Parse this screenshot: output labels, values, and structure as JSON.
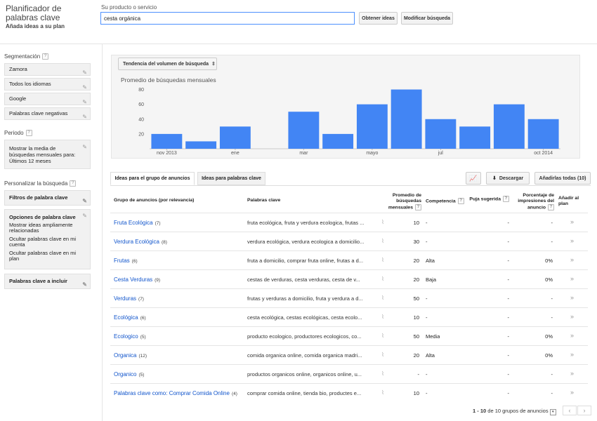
{
  "header": {
    "title": "Planificador de palabras clave",
    "subtitle": "Añada ideas a su plan",
    "product_label": "Su producto o servicio",
    "search_value": "cesta orgánica",
    "get_ideas_label": "Obtener ideas",
    "modify_label": "Modificar búsqueda"
  },
  "sidebar": {
    "segmentation_title": "Segmentación",
    "segmentation_items": [
      "Zamora",
      "Todos los idiomas",
      "Google",
      "Palabras clave negativas"
    ],
    "period_title": "Periodo",
    "period_text": "Mostrar la media de búsquedas mensuales para: Últimos 12 meses",
    "customize_title": "Personalizar la búsqueda",
    "filter_title": "Filtros de palabra clave",
    "options_title": "Opciones de palabra clave",
    "options_lines": [
      "Mostrar ideas ampliamente relacionadas",
      "Ocultar palabras clave en mi cuenta",
      "Ocultar palabras clave en mi plan"
    ],
    "include_title": "Palabras clave a incluir"
  },
  "chart": {
    "dropdown_label": "Tendencia del volumen de búsqueda",
    "bar_color": "#4285f4"
  },
  "chart_data": {
    "type": "bar",
    "title": "Promedio de búsquedas mensuales",
    "categories": [
      "nov 2013",
      "dic 2013",
      "ene 2014",
      "feb 2014",
      "mar 2014",
      "abr 2014",
      "may 2014",
      "jun 2014",
      "jul 2014",
      "ago 2014",
      "sep 2014",
      "oct 2014"
    ],
    "tick_labels": [
      "nov 2013",
      "ene",
      "mar",
      "mayo",
      "jul",
      "oct 2014"
    ],
    "tick_indices": [
      0,
      2,
      4,
      6,
      8,
      11
    ],
    "values": [
      20,
      10,
      30,
      0,
      50,
      20,
      60,
      80,
      40,
      30,
      60,
      40
    ],
    "yticks": [
      20,
      40,
      60,
      80
    ],
    "ylim": [
      0,
      90
    ]
  },
  "tabs": {
    "tab1": "Ideas para el grupo de anuncios",
    "tab2": "Ideas para palabras clave",
    "download": "Descargar",
    "add_all": "Añadirlas todas (10)"
  },
  "table": {
    "headers": {
      "group": "Grupo de anuncios (por relevancia)",
      "keywords": "Palabras clave",
      "avg": "Promedio de búsquedas mensuales",
      "competition": "Competencia",
      "bid": "Puja sugerida",
      "impr": "Porcentaje de impresiones del anuncio",
      "add": "Añadir al plan"
    },
    "rows": [
      {
        "group": "Fruta Ecológica",
        "count": "(7)",
        "keywords": "fruta ecológica, fruta y verdura ecologica, frutas ...",
        "avg": "10",
        "comp": "-",
        "bid": "-",
        "impr": "-"
      },
      {
        "group": "Verdura Ecológica",
        "count": "(8)",
        "keywords": "verdura ecológica, verdura ecologica a domicilio...",
        "avg": "30",
        "comp": "-",
        "bid": "-",
        "impr": "-"
      },
      {
        "group": "Frutas",
        "count": "(6)",
        "keywords": "fruta a domicilio, comprar fruta online, frutas a d...",
        "avg": "20",
        "comp": "Alta",
        "bid": "-",
        "impr": "0%"
      },
      {
        "group": "Cesta Verduras",
        "count": "(9)",
        "keywords": "cestas de verduras, cesta verduras, cesta de v...",
        "avg": "20",
        "comp": "Baja",
        "bid": "-",
        "impr": "0%"
      },
      {
        "group": "Verduras",
        "count": "(7)",
        "keywords": "frutas y verduras a domicilio, fruta y verdura a d...",
        "avg": "50",
        "comp": "-",
        "bid": "-",
        "impr": "-"
      },
      {
        "group": "Ecológica",
        "count": "(6)",
        "keywords": "cesta ecológica, cestas ecológicas, cesta ecolo...",
        "avg": "10",
        "comp": "-",
        "bid": "-",
        "impr": "-"
      },
      {
        "group": "Ecologico",
        "count": "(5)",
        "keywords": "producto ecologico, productores ecologicos, co...",
        "avg": "50",
        "comp": "Media",
        "bid": "-",
        "impr": "0%"
      },
      {
        "group": "Organica",
        "count": "(12)",
        "keywords": "comida organica online, comida organica madri...",
        "avg": "20",
        "comp": "Alta",
        "bid": "-",
        "impr": "0%"
      },
      {
        "group": "Organico",
        "count": "(5)",
        "keywords": "productos organicos online, organicos online, u...",
        "avg": "-",
        "comp": "-",
        "bid": "-",
        "impr": "-"
      },
      {
        "group": "Palabras clave como: Comprar Comida Online",
        "count": "(4)",
        "keywords": "comprar comida online, tienda bio, productes e...",
        "avg": "10",
        "comp": "-",
        "bid": "-",
        "impr": "-"
      }
    ]
  },
  "pagination": {
    "range": "1 - 10",
    "total_text": "de 10 grupos de anuncios"
  }
}
